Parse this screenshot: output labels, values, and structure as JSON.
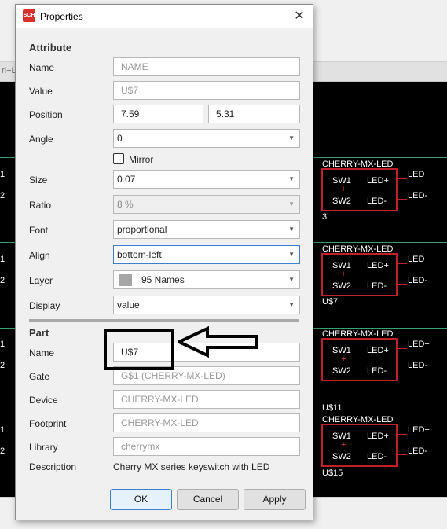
{
  "background": {
    "tab_fragment": "rl+L",
    "parts": [
      {
        "title": "CHERRY-MX-LED",
        "sw1": "SW1",
        "sw2": "SW2",
        "led_plus": "LED+",
        "led_minus": "LED-",
        "plus": "+",
        "net_plus": "LED+",
        "net_minus": "LED-",
        "name": "3"
      },
      {
        "title": "CHERRY-MX-LED",
        "sw1": "SW1",
        "sw2": "SW2",
        "led_plus": "LED+",
        "led_minus": "LED-",
        "plus": "+",
        "net_plus": "LED+",
        "net_minus": "LED-",
        "name": "U$7"
      },
      {
        "title": "CHERRY-MX-LED",
        "sw1": "SW1",
        "sw2": "SW2",
        "led_plus": "LED+",
        "led_minus": "LED-",
        "plus": "+",
        "net_plus": "LED+",
        "net_minus": "LED-",
        "name": "U$11"
      },
      {
        "title": "CHERRY-MX-LED",
        "sw1": "SW1",
        "sw2": "SW2",
        "led_plus": "LED+",
        "led_minus": "LED-",
        "plus": "+",
        "net_plus": "LED+",
        "net_minus": "LED-",
        "name": "U$15"
      }
    ],
    "left_numbers": [
      "1",
      "2",
      "1",
      "2",
      "1",
      "2",
      "1",
      "2"
    ]
  },
  "dialog": {
    "icon_text": "SCH",
    "title": "Properties",
    "attribute": {
      "heading": "Attribute",
      "name_label": "Name",
      "name_value": "NAME",
      "value_label": "Value",
      "value_value": "U$7",
      "position_label": "Position",
      "position_x": "7.59",
      "position_y": "5.31",
      "angle_label": "Angle",
      "angle_value": "0",
      "mirror_label": "Mirror",
      "mirror_checked": false,
      "size_label": "Size",
      "size_value": "0.07",
      "ratio_label": "Ratio",
      "ratio_value": "8 %",
      "font_label": "Font",
      "font_value": "proportional",
      "align_label": "Align",
      "align_value": "bottom-left",
      "layer_label": "Layer",
      "layer_value": "95 Names",
      "layer_color": "#a6a6a6",
      "display_label": "Display",
      "display_value": "value"
    },
    "part": {
      "heading": "Part",
      "name_label": "Name",
      "name_value": "U$7",
      "gate_label": "Gate",
      "gate_value": "G$1 (CHERRY-MX-LED)",
      "device_label": "Device",
      "device_value": "CHERRY-MX-LED",
      "footprint_label": "Footprint",
      "footprint_value": "CHERRY-MX-LED",
      "library_label": "Library",
      "library_value": "cherrymx",
      "description_label": "Description",
      "description_value": "Cherry MX series keyswitch with LED"
    },
    "buttons": {
      "ok": "OK",
      "cancel": "Cancel",
      "apply": "Apply"
    }
  }
}
